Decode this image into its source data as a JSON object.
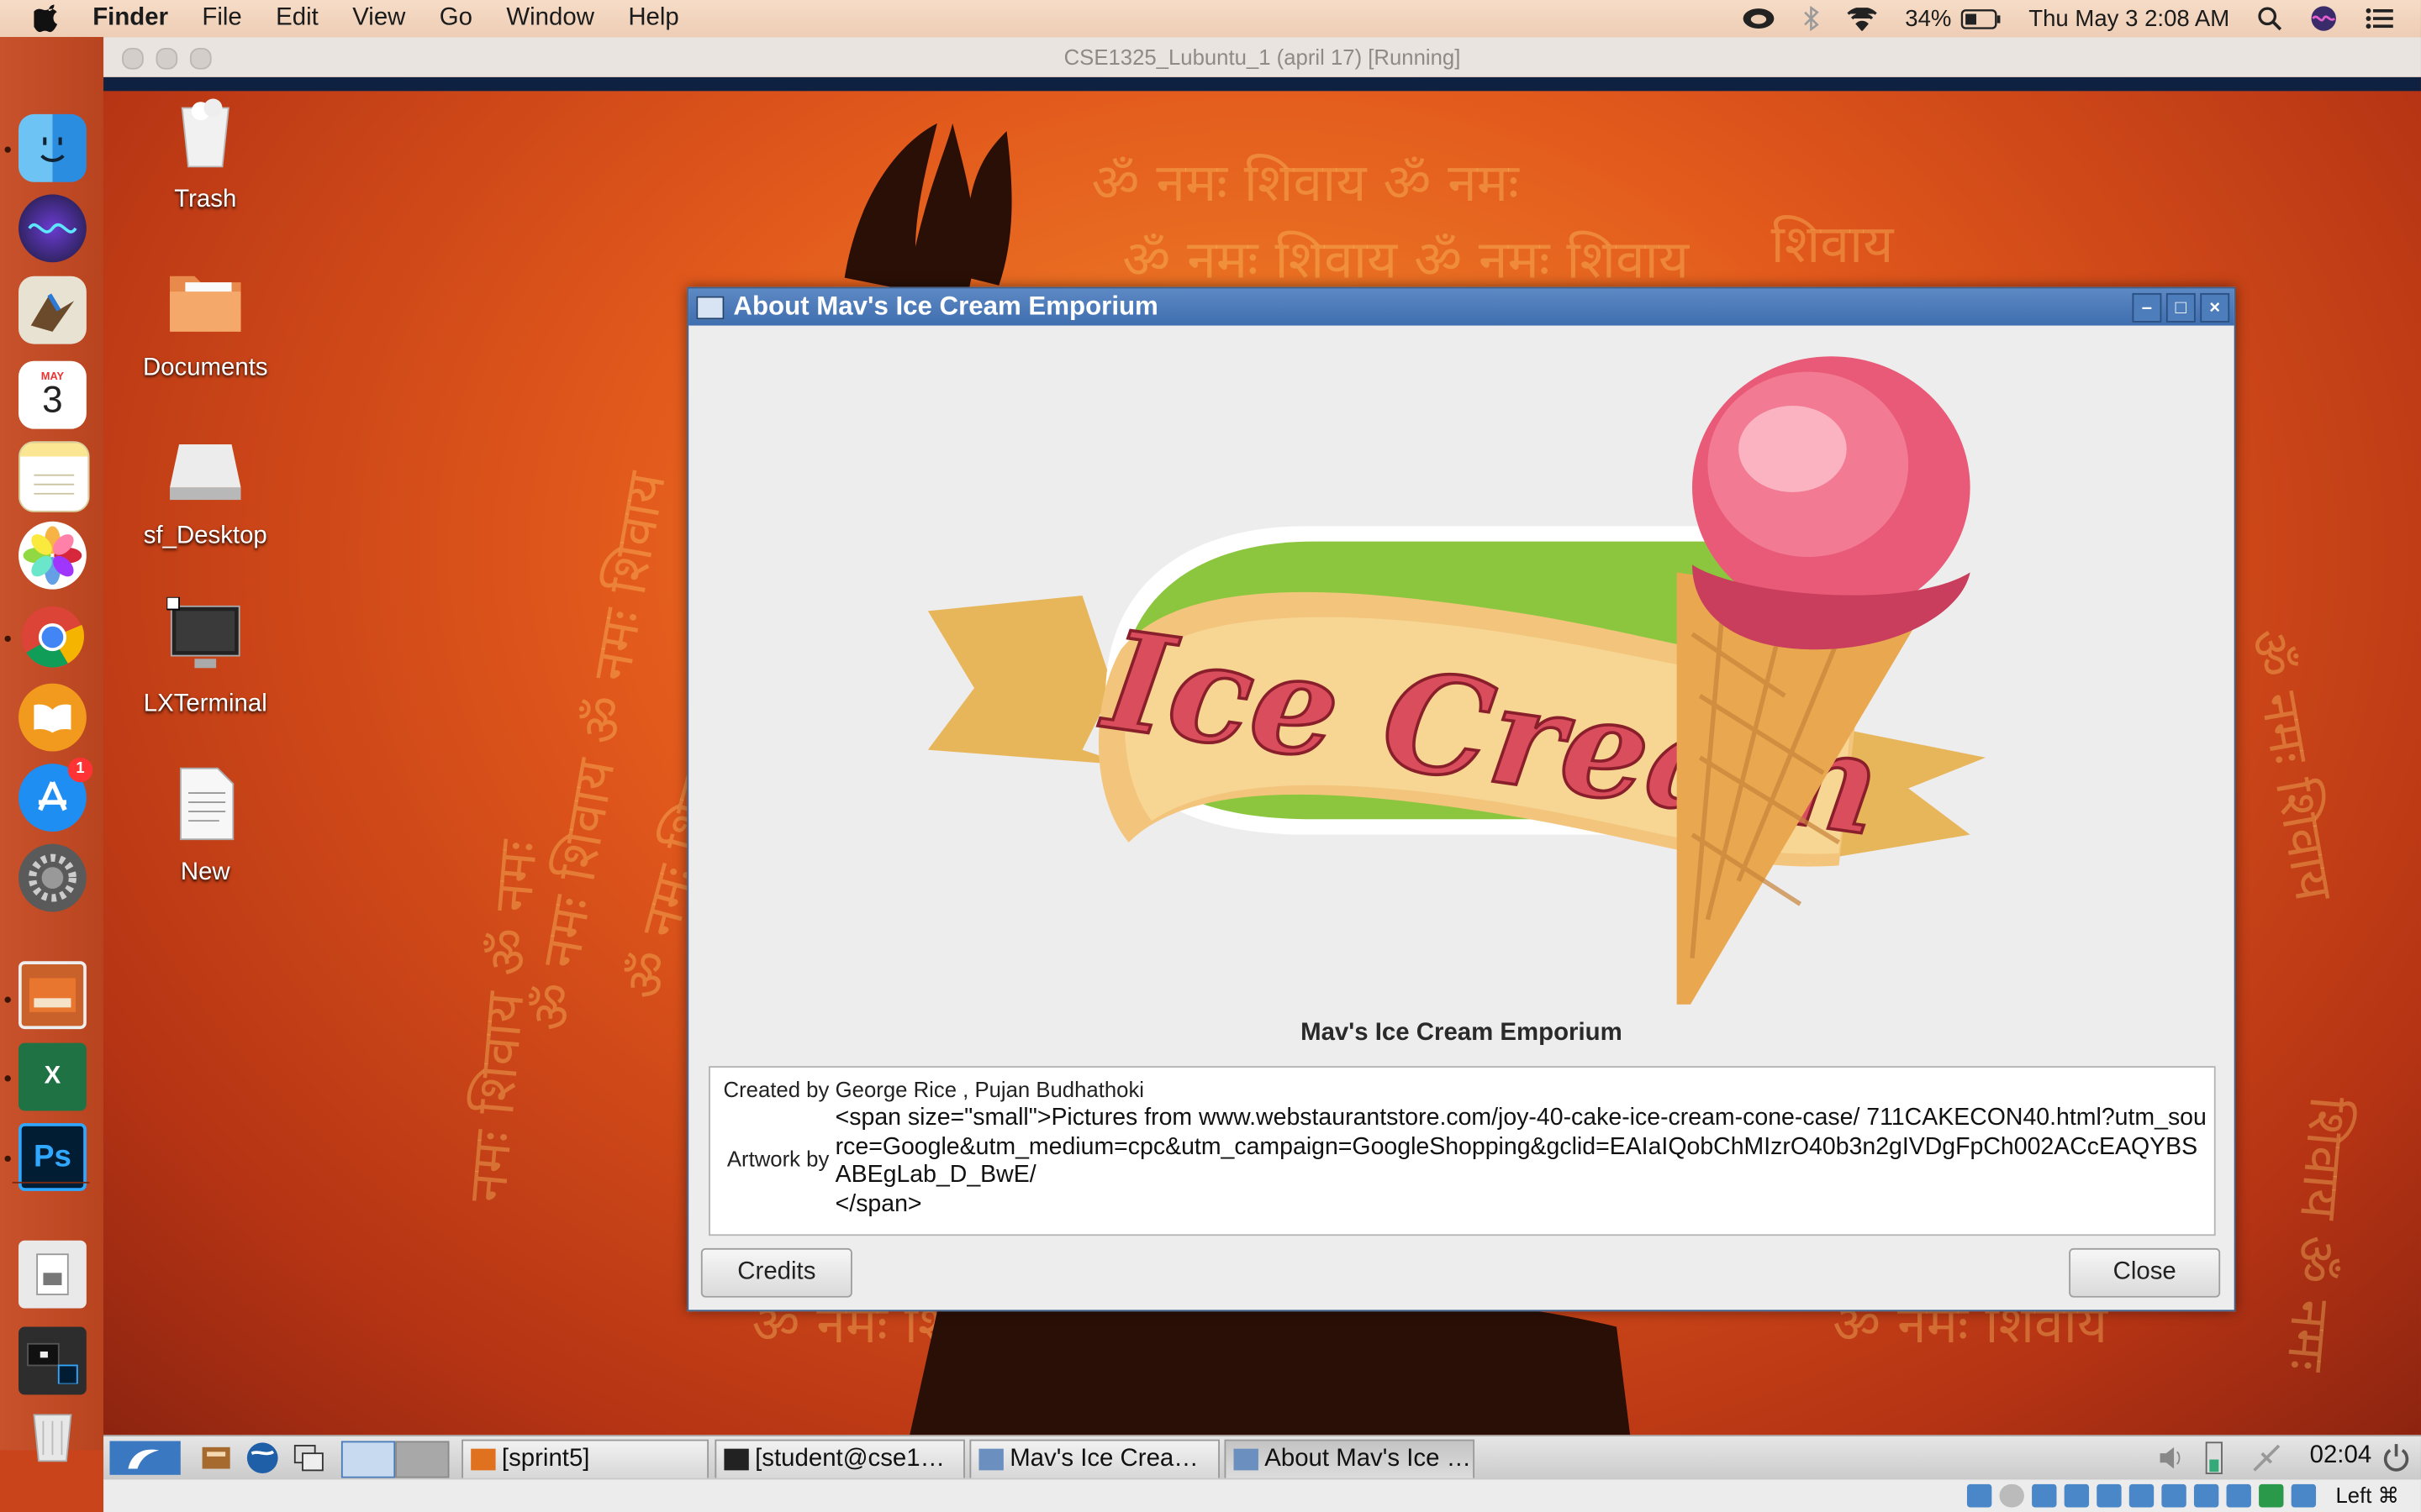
{
  "menubar": {
    "app_name": "Finder",
    "menus": [
      "File",
      "Edit",
      "View",
      "Go",
      "Window",
      "Help"
    ],
    "battery": "34%",
    "datetime": "Thu May 3  2:08 AM"
  },
  "dock": {
    "apps": [
      "finder-icon",
      "siri-icon",
      "mail-icon",
      "calendar-icon",
      "notes-icon",
      "photos-icon",
      "chrome-icon",
      "ibooks-icon",
      "app-store-icon",
      "system-preferences-icon",
      "virtualbox-icon",
      "excel-icon",
      "photoshop-icon",
      "downloads-icon",
      "recent-apps-icon",
      "trash-icon"
    ],
    "calendar_month": "MAY",
    "calendar_day": "3",
    "appstore_badge": "1",
    "photoshop_label": "Ps",
    "excel_label": "X"
  },
  "vbox": {
    "title": "CSE1325_Lubuntu_1 (april 17) [Running]",
    "host_key": "Left ⌘"
  },
  "desktop": {
    "icons": [
      {
        "label": "Trash",
        "icon": "trash-icon"
      },
      {
        "label": "Documents",
        "icon": "folder-icon"
      },
      {
        "label": "sf_Desktop",
        "icon": "drive-icon"
      },
      {
        "label": "LXTerminal",
        "icon": "terminal-icon"
      },
      {
        "label": "New",
        "icon": "document-icon"
      }
    ]
  },
  "dialog": {
    "title": "About Mav's Ice Cream Emporium",
    "logo_text": "Ice Cream",
    "app_name": "Mav's Ice Cream Emporium",
    "created_by_label": "Created by",
    "created_by": "George Rice , Pujan Budhathoki",
    "artwork_by_label": "Artwork by",
    "artwork_markup": "<span size=\"small\">Pictures from www.webstaurantstore.com/joy-40-cake-ice-cream-cone-case/ 711CAKECON40.html?utm_source=Google&utm_medium=cpc&utm_campaign=GoogleShopping&gclid=EAIaIQobChMIzrO40b3n2gIVDgFpCh002ACcEAQYBSABEgLab_D_BwE/",
    "artwork_markup_end": "</span>",
    "credits_label": "Credits",
    "close_label": "Close"
  },
  "panel": {
    "tasks": [
      "[sprint5]",
      "[student@cse1…",
      "Mav's Ice Crea…",
      "About Mav's Ice …"
    ],
    "clock": "02:04"
  }
}
